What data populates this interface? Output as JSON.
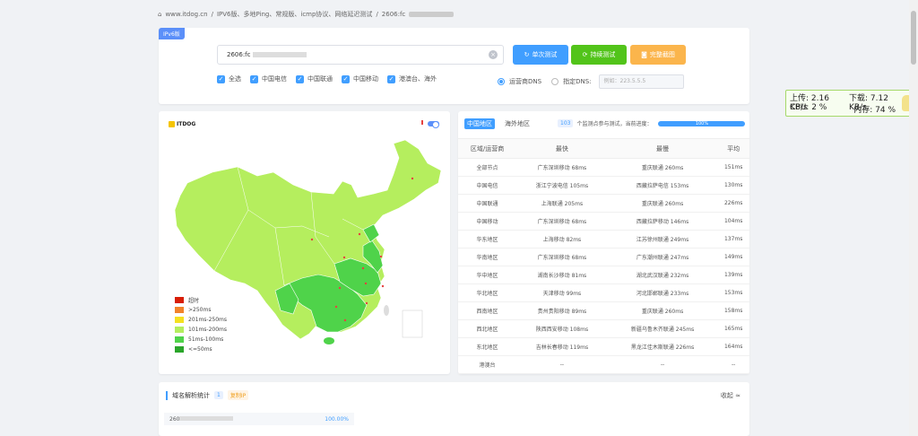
{
  "breadcrumb": {
    "home": "www.itdog.cn",
    "sep": "/",
    "crumb1": "IPV6版、多地Ping、常规版、icmp协议、网络延迟测试",
    "crumb2": "2606:fc"
  },
  "top": {
    "badge": "IPv6版",
    "search_value": "2606:fc",
    "buttons": {
      "single": "单次测试",
      "continuous": "持续测试",
      "screenshot": "完整截图"
    },
    "checks": [
      "全选",
      "中国电信",
      "中国联通",
      "中国移动",
      "港澳台、海外"
    ],
    "dns": {
      "operator": "运营商DNS",
      "custom": "指定DNS:",
      "placeholder": "例如：223.5.5.5"
    }
  },
  "map": {
    "logo": "ITDOG",
    "legend": [
      {
        "label": "超时",
        "color": "#d81e06"
      },
      {
        "label": ">250ms",
        "color": "#f2832b"
      },
      {
        "label": "201ms-250ms",
        "color": "#f5e020"
      },
      {
        "label": "101ms-200ms",
        "color": "#b5ee5e"
      },
      {
        "label": "51ms-100ms",
        "color": "#4fd34a"
      },
      {
        "label": "<=50ms",
        "color": "#2aa52a"
      }
    ]
  },
  "results": {
    "tabs": [
      "中国地区",
      "海外地区"
    ],
    "count": "103",
    "progress_text": "个监测点参与测试，当前进度：",
    "progress": "100%",
    "headers": [
      "区域/运营商",
      "最快",
      "最慢",
      "平均"
    ],
    "rows": [
      [
        "全部节点",
        "广东深圳移动 68ms",
        "重庆联通 260ms",
        "151ms"
      ],
      [
        "中国电信",
        "浙江宁波电信 105ms",
        "西藏拉萨电信 153ms",
        "130ms"
      ],
      [
        "中国联通",
        "上海联通 205ms",
        "重庆联通 260ms",
        "226ms"
      ],
      [
        "中国移动",
        "广东深圳移动 68ms",
        "西藏拉萨移动 146ms",
        "104ms"
      ],
      [
        "华东地区",
        "上海移动 82ms",
        "江苏徐州联通 249ms",
        "137ms"
      ],
      [
        "华南地区",
        "广东深圳移动 68ms",
        "广东潮州联通 247ms",
        "149ms"
      ],
      [
        "华中地区",
        "湖南长沙移动 81ms",
        "湖北武汉联通 232ms",
        "139ms"
      ],
      [
        "华北地区",
        "天津移动 99ms",
        "河北邯郸联通 233ms",
        "153ms"
      ],
      [
        "西南地区",
        "贵州贵阳移动 89ms",
        "重庆联通 260ms",
        "158ms"
      ],
      [
        "西北地区",
        "陕西西安移动 108ms",
        "新疆乌鲁木齐联通 245ms",
        "165ms"
      ],
      [
        "东北地区",
        "吉林长春移动 119ms",
        "黑龙江佳木斯联通 226ms",
        "164ms"
      ],
      [
        "港澳台",
        "--",
        "--",
        "--"
      ]
    ]
  },
  "dns_stats": {
    "title": "域名解析统计",
    "count": "1",
    "copy": "复制IP",
    "collapse": "收起 ≈",
    "ip": "260",
    "pct": "100.00%"
  },
  "net_widget": {
    "up": "上传: 2.16 KB/s",
    "down": "下载: 7.12 KB/s",
    "cpu": "CPU: 2 %",
    "mem": "内存: 74 %"
  }
}
